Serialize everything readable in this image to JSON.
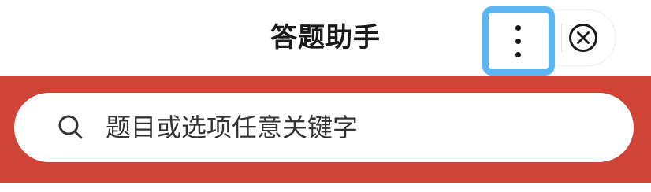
{
  "header": {
    "title": "答题助手",
    "more_icon": "more-vertical-icon",
    "close_icon": "close-circle-icon",
    "highlight_color": "#5ab6f2"
  },
  "search": {
    "placeholder": "题目或选项任意关键字",
    "icon": "search-icon",
    "band_color": "#cf4437"
  }
}
